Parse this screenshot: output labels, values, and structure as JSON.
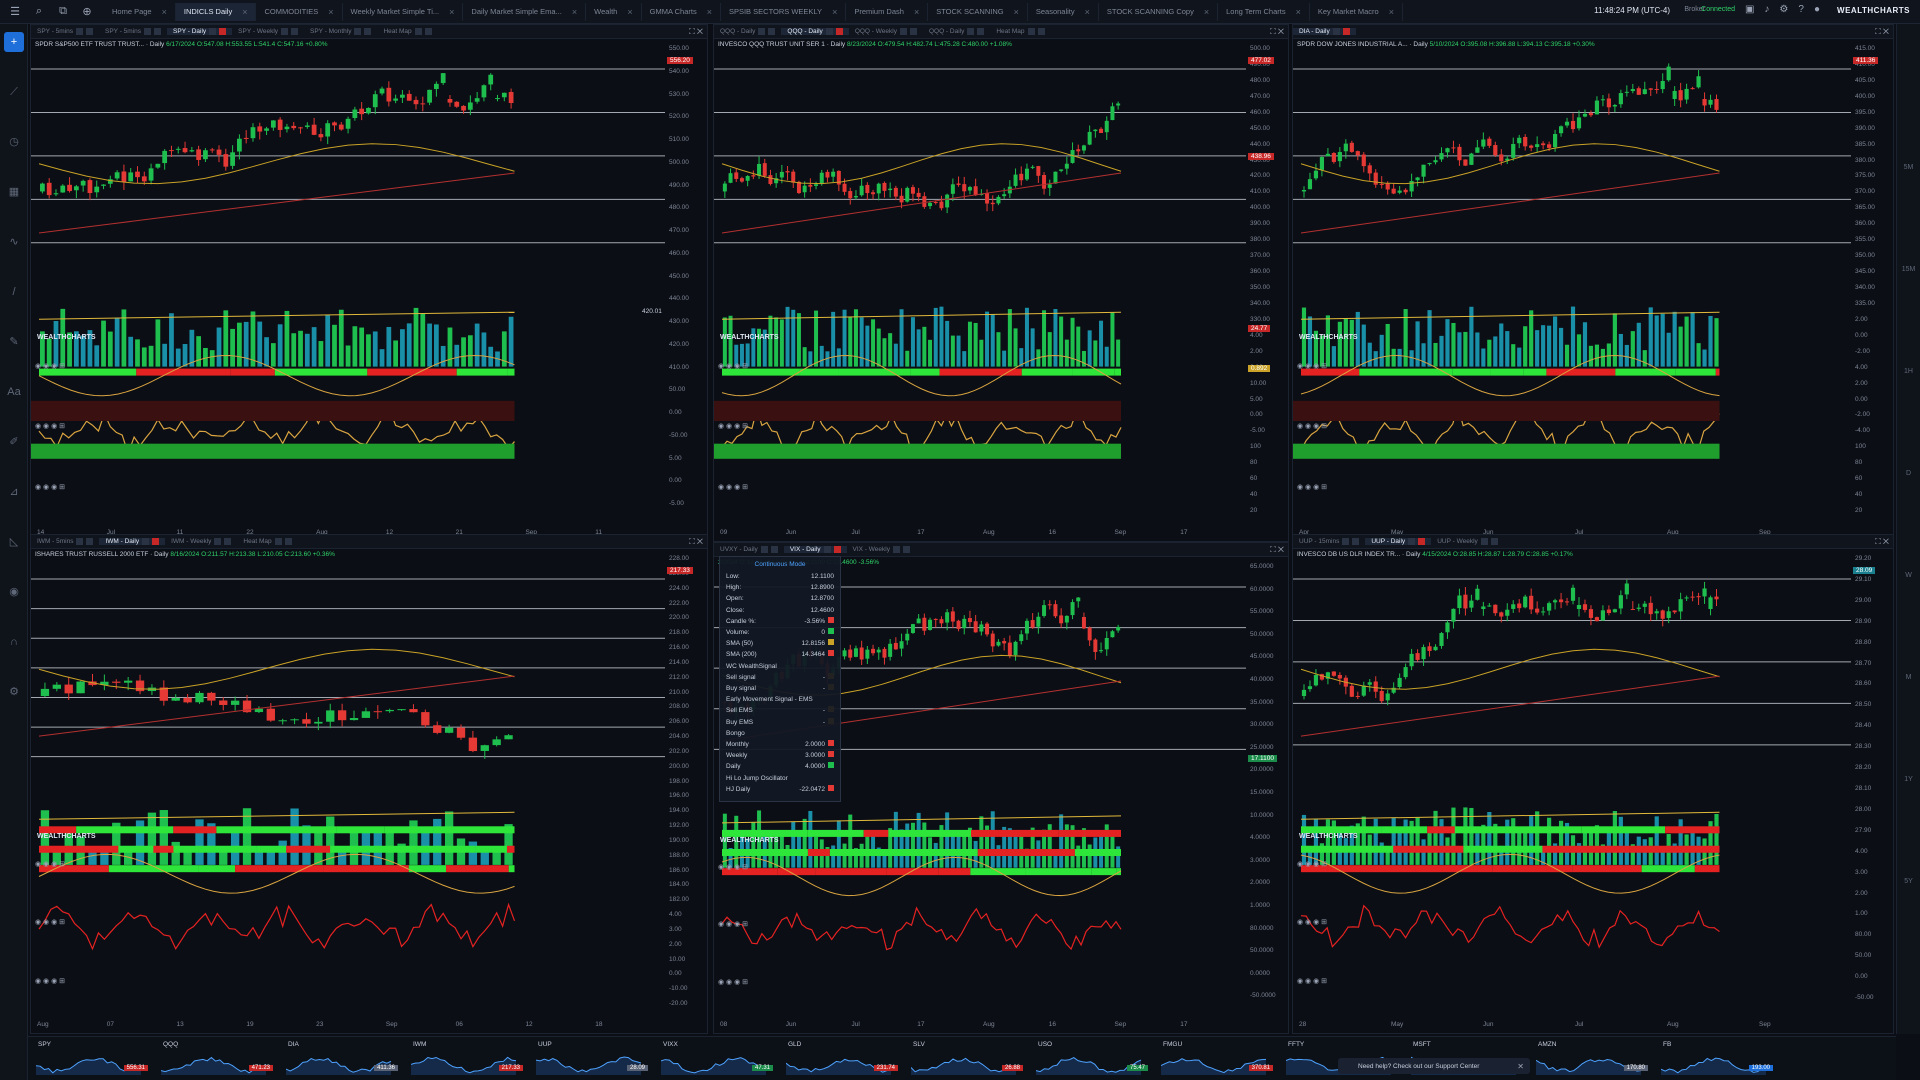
{
  "app": {
    "brand": "WEALTHCHARTS",
    "clock": "11:48:24 PM (UTC-4)",
    "broker": "Broker",
    "connection": "Connected"
  },
  "tabs": [
    {
      "label": "Home Page",
      "active": false
    },
    {
      "label": "INDICLS Daily",
      "active": true
    },
    {
      "label": "COMMODITIES",
      "active": false
    },
    {
      "label": "Weekly Market Simple Ti...",
      "active": false
    },
    {
      "label": "Daily Market Simple Ema...",
      "active": false
    },
    {
      "label": "Wealth",
      "active": false
    },
    {
      "label": "GMMA Charts",
      "active": false
    },
    {
      "label": "SPSIB SECTORS WEEKLY",
      "active": false
    },
    {
      "label": "Premium Dash",
      "active": false
    },
    {
      "label": "STOCK SCANNING",
      "active": false
    },
    {
      "label": "Seasonality",
      "active": false
    },
    {
      "label": "STOCK SCANNING Copy",
      "active": false
    },
    {
      "label": "Long Term Charts",
      "active": false
    },
    {
      "label": "Key Market Macro",
      "active": false
    }
  ],
  "panels": [
    {
      "subtabs": [
        "SPY - 5mins",
        "SPY - 5mins",
        "SPY - Daily",
        "SPY - Weekly",
        "SPY - Monthly",
        "Heat Map"
      ],
      "active": 2,
      "title": "SPDR S&P500 ETF TRUST TRUST... · Daily",
      "ohlc": "6/17/2024 O:547.08 H:553.55 L:541.4 C:547.16 +0.80%",
      "yticks": [
        "550.00",
        "540.00",
        "530.00",
        "520.00",
        "510.00",
        "500.00",
        "490.00",
        "480.00",
        "470.00",
        "460.00",
        "450.00",
        "440.00",
        "430.00",
        "420.00",
        "410.00",
        "50.00",
        "0.00",
        "-50.00",
        "5.00",
        "0.00",
        "-5.00"
      ],
      "xticks": [
        "14",
        "Jul",
        "11",
        "22",
        "Aug",
        "12",
        "21",
        "Sep",
        "11"
      ],
      "price_label": "556.20",
      "vol_label": "420.01"
    },
    {
      "subtabs": [
        "QQQ - Daily",
        "QQQ - Daily",
        "QQQ - Weekly",
        "QQQ - Daily",
        "Heat Map"
      ],
      "active": 1,
      "title": "INVESCO QQQ TRUST UNIT SER 1 · Daily",
      "ohlc": "8/23/2024 O:479.54 H:482.74 L:475.28 C:480.00 +1.08%",
      "yticks": [
        "500.00",
        "490.00",
        "480.00",
        "470.00",
        "460.00",
        "450.00",
        "440.00",
        "430.00",
        "420.00",
        "410.00",
        "400.00",
        "390.00",
        "380.00",
        "370.00",
        "360.00",
        "350.00",
        "340.00",
        "330.00",
        "4.00",
        "2.00",
        "0.00",
        "10.00",
        "5.00",
        "0.00",
        "-5.00",
        "100",
        "80",
        "60",
        "40",
        "20"
      ],
      "xticks": [
        "09",
        "Jun",
        "Jul",
        "17",
        "Aug",
        "16",
        "Sep",
        "17"
      ],
      "price_label": "477.02",
      "price_label2": "438.96",
      "mid_label": "24.77",
      "mid_label2": "0.892"
    },
    {
      "subtabs": [
        "DIA - Daily"
      ],
      "active": 0,
      "title": "SPDR DOW JONES INDUSTRIAL A... · Daily",
      "ohlc": "5/10/2024 O:395.08 H:396.88 L:394.13 C:395.18 +0.30%",
      "yticks": [
        "415.00",
        "410.00",
        "405.00",
        "400.00",
        "395.00",
        "390.00",
        "385.00",
        "380.00",
        "375.00",
        "370.00",
        "365.00",
        "360.00",
        "355.00",
        "350.00",
        "345.00",
        "340.00",
        "335.00",
        "2.00",
        "0.00",
        "-2.00",
        "4.00",
        "2.00",
        "0.00",
        "-2.00",
        "-4.00",
        "100",
        "80",
        "60",
        "40",
        "20"
      ],
      "xticks": [
        "Apr",
        "May",
        "Jun",
        "Jul",
        "Aug",
        "Sep"
      ],
      "price_label": "411.36"
    },
    {
      "subtabs": [
        "IWM - 5mins",
        "IWM - Daily",
        "IWM - Weekly",
        "Heat Map"
      ],
      "active": 1,
      "title": "ISHARES TRUST RUSSELL 2000 ETF · Daily",
      "ohlc": "8/16/2024 O:211.57 H:213.38 L:210.05 C:213.60 +0.36%",
      "yticks": [
        "228.00",
        "226.00",
        "224.00",
        "222.00",
        "220.00",
        "218.00",
        "216.00",
        "214.00",
        "212.00",
        "210.00",
        "208.00",
        "206.00",
        "204.00",
        "202.00",
        "200.00",
        "198.00",
        "196.00",
        "194.00",
        "192.00",
        "190.00",
        "188.00",
        "186.00",
        "184.00",
        "182.00",
        "4.00",
        "3.00",
        "2.00",
        "10.00",
        "0.00",
        "-10.00",
        "-20.00"
      ],
      "xticks": [
        "Aug",
        "07",
        "13",
        "19",
        "23",
        "Sep",
        "06",
        "12",
        "18"
      ],
      "price_label": "217.33"
    },
    {
      "subtabs": [
        "UVXY - Daily",
        "VIX - Daily",
        "VIX - Weekly"
      ],
      "active": 1,
      "title": "",
      "ohlc": "2/2024 O:12.86 H:12.8900 L:12.1100 C:12.4600 -3.56%",
      "yticks": [
        "65.0000",
        "60.0000",
        "55.0000",
        "50.0000",
        "45.0000",
        "40.0000",
        "35.0000",
        "30.0000",
        "25.0000",
        "20.0000",
        "15.0000",
        "10.0000",
        "4.0000",
        "3.0000",
        "2.0000",
        "1.0000",
        "80.0000",
        "50.0000",
        "0.0000",
        "-50.0000"
      ],
      "xticks": [
        "08",
        "Jun",
        "Jul",
        "17",
        "Aug",
        "16",
        "Sep",
        "17"
      ],
      "price_label": "17.1100"
    },
    {
      "subtabs": [
        "UUP - 15mins",
        "UUP - Daily",
        "UUP - Weekly"
      ],
      "active": 1,
      "title": "INVESCO DB US DLR INDEX TR... · Daily",
      "ohlc": "4/15/2024 O:28.85 H:28.87 L:28.79 C:28.85 +0.17%",
      "yticks": [
        "29.20",
        "29.10",
        "29.00",
        "28.90",
        "28.80",
        "28.70",
        "28.60",
        "28.50",
        "28.40",
        "28.30",
        "28.20",
        "28.10",
        "28.00",
        "27.90",
        "4.00",
        "3.00",
        "2.00",
        "1.00",
        "80.00",
        "50.00",
        "0.00",
        "-50.00"
      ],
      "xticks": [
        "28",
        "May",
        "Jun",
        "Jul",
        "Aug",
        "Sep"
      ],
      "price_label": "28.09"
    }
  ],
  "tooltip": {
    "header": "Continuous Mode",
    "rows": [
      {
        "k": "Low:",
        "v": "12.1100",
        "c": ""
      },
      {
        "k": "High:",
        "v": "12.8900",
        "c": ""
      },
      {
        "k": "Open:",
        "v": "12.8700",
        "c": ""
      },
      {
        "k": "Close:",
        "v": "12.4600",
        "c": ""
      },
      {
        "k": "Candle %:",
        "v": "-3.56%",
        "c": "#e53935"
      },
      {
        "k": "Volume:",
        "v": "0",
        "c": "#1fbf4f"
      },
      {
        "k": "SMA (50)",
        "v": "12.8156",
        "c": "#c9a227"
      },
      {
        "k": "SMA (200)",
        "v": "14.3464",
        "c": "#e53935"
      },
      {
        "k": "WC WealthSignal",
        "v": "",
        "c": ""
      },
      {
        "k": "  Sell signal",
        "v": "-",
        "c": "#222"
      },
      {
        "k": "  Buy signal",
        "v": "-",
        "c": "#222"
      },
      {
        "k": "Early Movement Signal - EMS",
        "v": "",
        "c": ""
      },
      {
        "k": "  Sell EMS",
        "v": "-",
        "c": "#222"
      },
      {
        "k": "  Buy EMS",
        "v": "-",
        "c": "#222"
      },
      {
        "k": "Bongo",
        "v": "",
        "c": ""
      },
      {
        "k": "  Monthly",
        "v": "2.0000",
        "c": "#e53935"
      },
      {
        "k": "  Weekly",
        "v": "3.0000",
        "c": "#e53935"
      },
      {
        "k": "  Daily",
        "v": "4.0000",
        "c": "#1fbf4f"
      },
      {
        "k": "Hi Lo Jump Oscillator",
        "v": "",
        "c": ""
      },
      {
        "k": "  HJ Daily",
        "v": "-22.0472",
        "c": "#e53935"
      }
    ]
  },
  "ticker": [
    {
      "symbol": "SPY",
      "price": "556.31",
      "color": "#c62828"
    },
    {
      "symbol": "QQQ",
      "price": "471.23",
      "color": "#c62828"
    },
    {
      "symbol": "DIA",
      "price": "411.36",
      "color": "#5a6375"
    },
    {
      "symbol": "IWM",
      "price": "217.33",
      "color": "#c62828"
    },
    {
      "symbol": "UUP",
      "price": "28.09",
      "color": "#5a6375"
    },
    {
      "symbol": "VIXX",
      "price": "47.31",
      "color": "#1b8c4a"
    },
    {
      "symbol": "GLD",
      "price": "231.74",
      "color": "#c62828"
    },
    {
      "symbol": "SLV",
      "price": "26.88",
      "color": "#c62828"
    },
    {
      "symbol": "USO",
      "price": "75.47",
      "color": "#1b8c4a"
    },
    {
      "symbol": "FMGU",
      "price": "370.81",
      "color": "#c62828"
    },
    {
      "symbol": "FFTY",
      "price": "",
      "color": "#5a6375"
    },
    {
      "symbol": "MSFT",
      "price": "",
      "color": "#5a6375"
    },
    {
      "symbol": "AMZN",
      "price": "170.80",
      "color": "#5a6375"
    },
    {
      "symbol": "FB",
      "price": "193.00",
      "color": "#1e6fd9"
    }
  ],
  "help": "Need help? Check out our Support Center",
  "right_rail": [
    "5M",
    "15M",
    "1H",
    "D",
    "W",
    "M",
    "1Y",
    "5Y"
  ],
  "colors": {
    "up": "#1fbf4f",
    "down": "#e53935",
    "bg": "#0b0e14",
    "accent": "#1e6fd9"
  }
}
